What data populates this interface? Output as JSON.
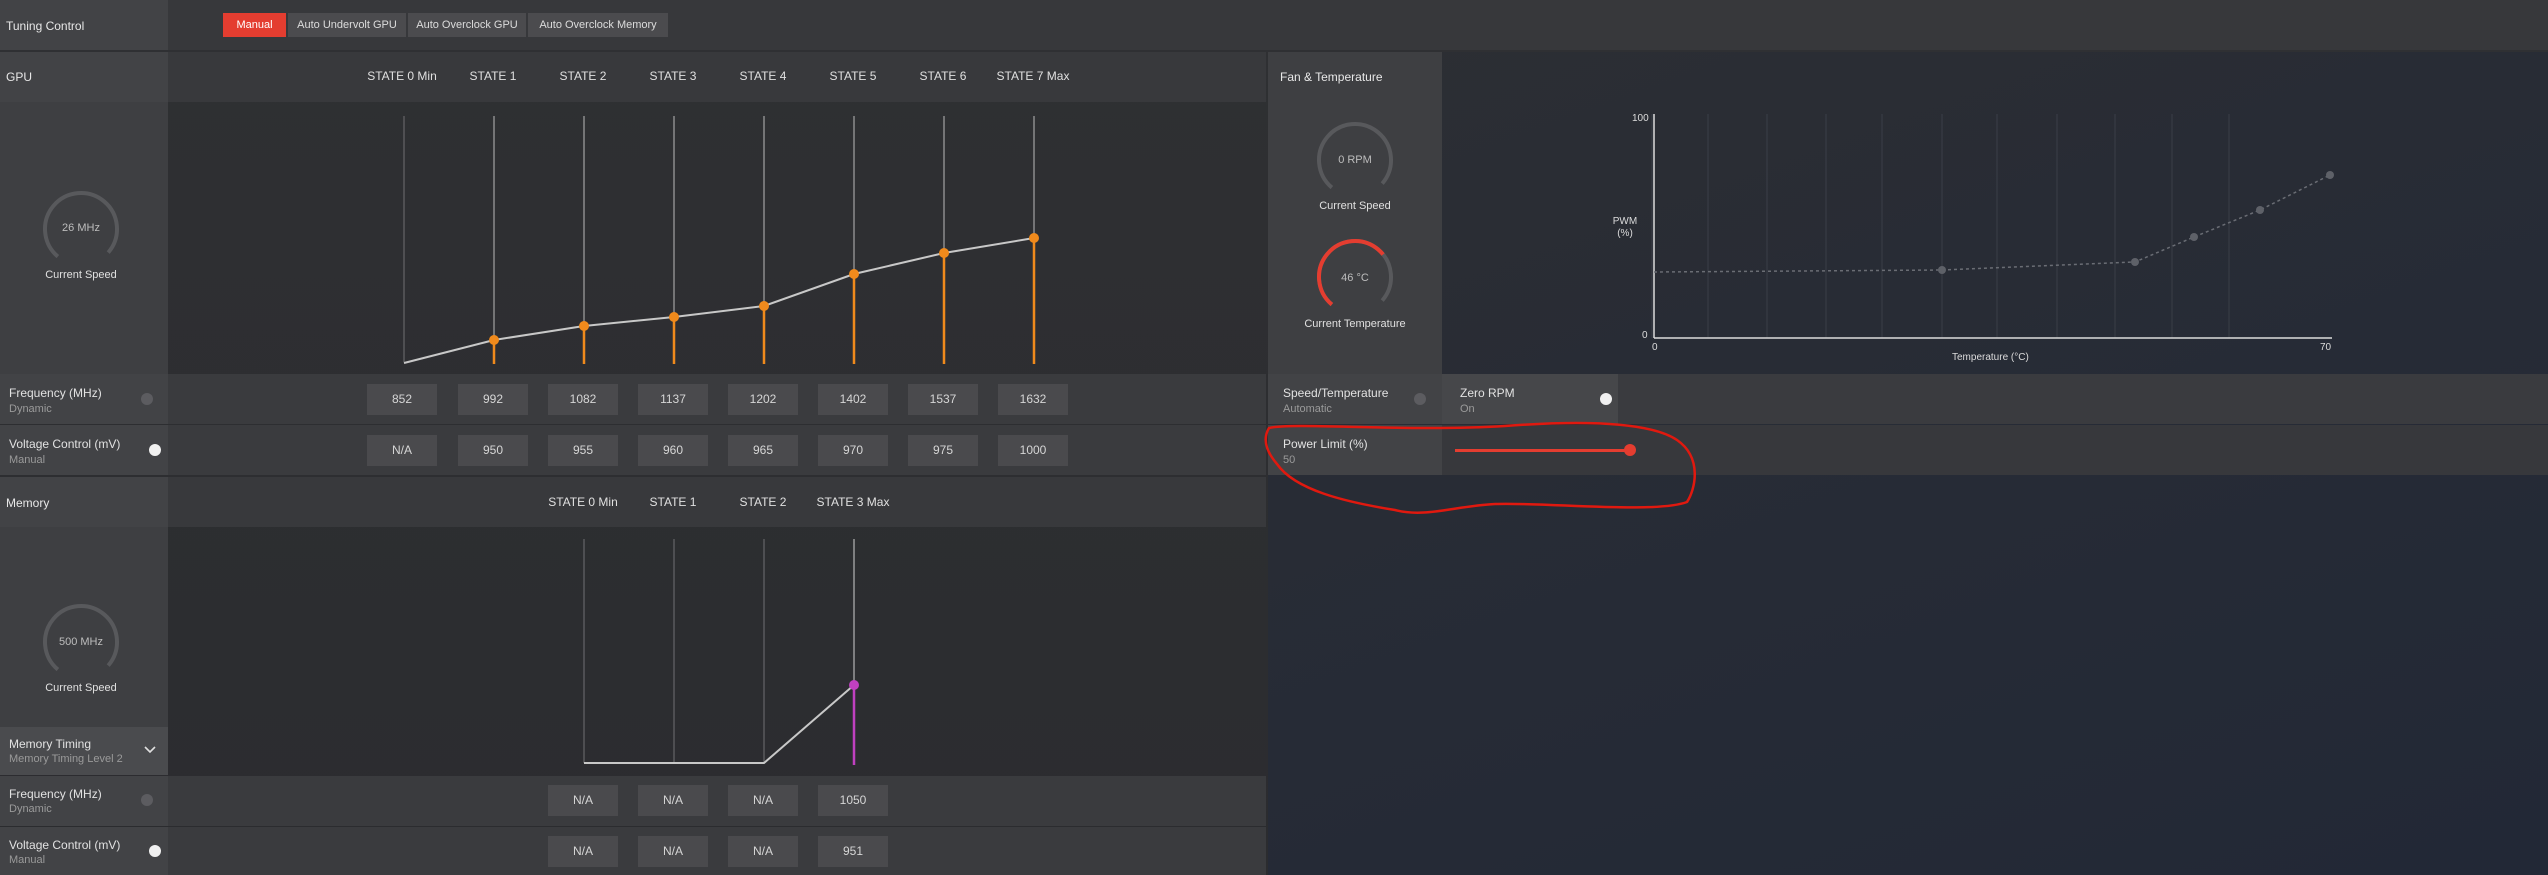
{
  "tuning": {
    "title": "Tuning Control",
    "buttons": [
      "Manual",
      "Auto Undervolt GPU",
      "Auto Overclock GPU",
      "Auto Overclock Memory"
    ],
    "active_button": "Manual",
    "accent": "#e43d30"
  },
  "gpu": {
    "title": "GPU",
    "states": [
      "STATE 0 Min",
      "STATE 1",
      "STATE 2",
      "STATE 3",
      "STATE 4",
      "STATE 5",
      "STATE 6",
      "STATE 7 Max"
    ],
    "current_speed": "26 MHz",
    "current_speed_label": "Current Speed",
    "frequency": {
      "label": "Frequency (MHz)",
      "mode": "Dynamic",
      "values": [
        "852",
        "992",
        "1082",
        "1137",
        "1202",
        "1402",
        "1537",
        "1632"
      ]
    },
    "voltage": {
      "label": "Voltage Control (mV)",
      "mode": "Manual",
      "values": [
        "N/A",
        "950",
        "955",
        "960",
        "965",
        "970",
        "975",
        "1000"
      ]
    },
    "curve_color": "#f08a1c"
  },
  "memory": {
    "title": "Memory",
    "states": [
      "STATE 0 Min",
      "STATE 1",
      "STATE 2",
      "STATE 3 Max"
    ],
    "current_speed": "500 MHz",
    "current_speed_label": "Current Speed",
    "timing": {
      "label": "Memory Timing",
      "value": "Memory Timing Level 2"
    },
    "frequency": {
      "label": "Frequency (MHz)",
      "mode": "Dynamic",
      "values": [
        "N/A",
        "N/A",
        "N/A",
        "1050"
      ]
    },
    "voltage": {
      "label": "Voltage Control (mV)",
      "mode": "Manual",
      "values": [
        "N/A",
        "N/A",
        "N/A",
        "951"
      ]
    },
    "curve_color": "#c040c0"
  },
  "fan": {
    "title": "Fan & Temperature",
    "speed": "0 RPM",
    "speed_label": "Current Speed",
    "temp": "46 °C",
    "temp_label": "Current Temperature",
    "chart": {
      "y_label": "PWM (%)",
      "x_label": "Temperature (°C)",
      "y_max": "100",
      "y_min": "0",
      "x_min": "0",
      "x_max": "70"
    },
    "speed_temp": {
      "label": "Speed/Temperature",
      "value": "Automatic"
    },
    "zero_rpm": {
      "label": "Zero RPM",
      "value": "On"
    },
    "power_limit": {
      "label": "Power Limit (%)",
      "value": "50"
    }
  }
}
